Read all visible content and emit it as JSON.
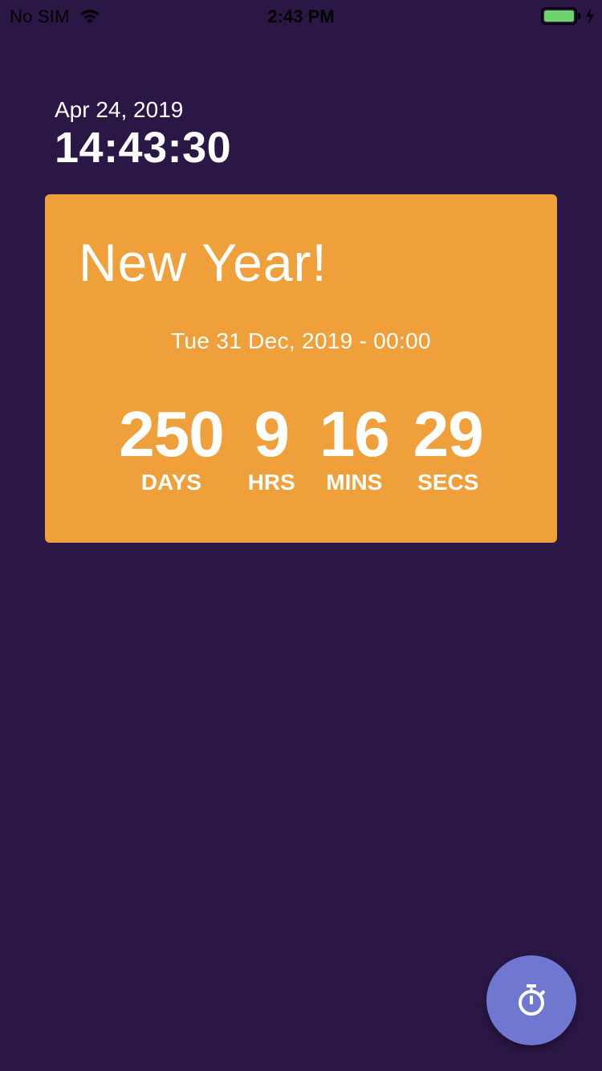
{
  "status_bar": {
    "carrier": "No SIM",
    "time": "2:43 PM",
    "icons": [
      "wifi-icon",
      "battery-icon",
      "charging-icon"
    ],
    "battery_color": "#6fd36b"
  },
  "clock": {
    "date": "Apr 24, 2019",
    "time": "14:43:30"
  },
  "countdown_card": {
    "title": "New Year!",
    "target_date": "Tue 31 Dec, 2019 - 00:00",
    "background_color": "#f0a03b",
    "units": [
      {
        "value": "250",
        "label": "DAYS"
      },
      {
        "value": "9",
        "label": "HRS"
      },
      {
        "value": "16",
        "label": "MINS"
      },
      {
        "value": "29",
        "label": "SECS"
      }
    ]
  },
  "fab": {
    "icon": "timer-icon",
    "color": "#7077d1"
  },
  "theme": {
    "background": "#2a1745"
  }
}
